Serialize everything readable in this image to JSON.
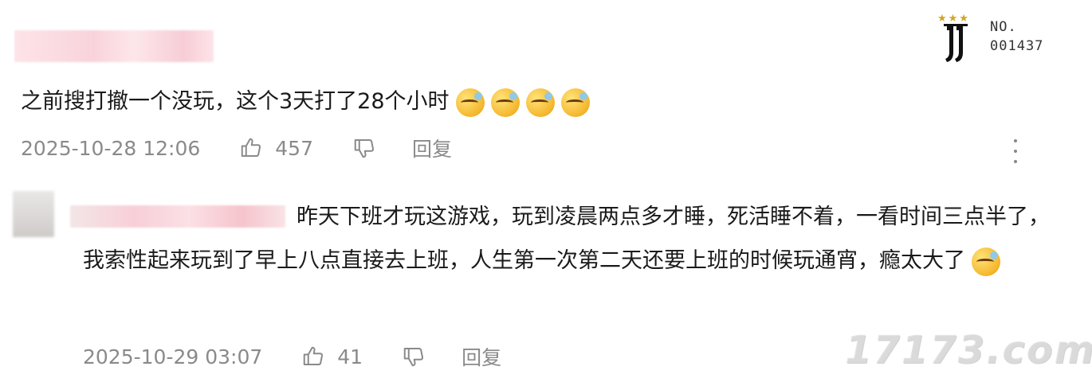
{
  "logo": {
    "no_label": "NO.",
    "no_value": "001437",
    "star_color": "#d4a520"
  },
  "comments": [
    {
      "text": "之前搜打撤一个没玩，这个3天打了28个小时",
      "emoji_count": 4,
      "time": "2025-10-28 12:06",
      "likes": "457",
      "reply_label": "回复"
    },
    {
      "text": "昨天下班才玩这游戏，玩到凌晨两点多才睡，死活睡不着，一看时间三点半了，我索性起来玩到了早上八点直接去上班，人生第一次第二天还要上班的时候玩通宵，瘾太大了",
      "emoji_count": 1,
      "time": "2025-10-29 03:07",
      "likes": "41",
      "reply_label": "回复"
    }
  ],
  "watermark": "17173.com",
  "colors": {
    "meta_text": "#8a8a8a",
    "body_text": "#1a1a1a"
  }
}
